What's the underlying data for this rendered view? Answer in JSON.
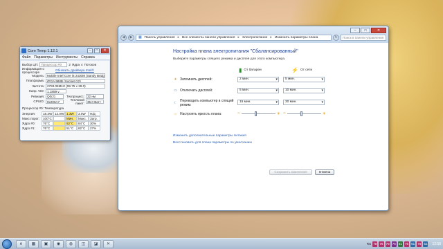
{
  "coretemp": {
    "title": "Core Temp 1.12.1",
    "menu": [
      "Файл",
      "Параметры",
      "Инструменты",
      "Справка"
    ],
    "cpu_select_label": "Выбор ЦП:",
    "cpu_select_value": "Процессор #0",
    "cores_value": "2",
    "cores_label": "Ядра",
    "threads_value": "4",
    "threads_label": "Потоков",
    "info_label": "Информация о процессоре",
    "info_link": "Обновить драйвера Intel®",
    "rows": [
      {
        "label": "Модель:",
        "value": "Mobile Intel Core i5 2430M (Sandy Bridge)"
      },
      {
        "label": "Платформа:",
        "value": "rPGA 988B (Socket G2)"
      },
      {
        "label": "Частота:",
        "value": "2793.08MHz (99.75 x 28.0)"
      },
      {
        "label": "Напр. VID:",
        "value": "1.1859 v"
      }
    ],
    "revision_label": "Ревизия:",
    "revision_value": "Q0/J1",
    "lithography_label": "Техпроцесс:",
    "lithography_value": "32 нм",
    "cpuid_label": "CPUID:",
    "cpuid_value": "0x206A7",
    "tdp_label": "Тепловой пакет:",
    "tdp_value": "35.0 Ватт",
    "proc_temp_label": "Процессор #0: Температура",
    "grid": {
      "rows": [
        {
          "label": "Энергия:",
          "cells": [
            "18.3W",
            "12.0W",
            "1.3W",
            "3.0W",
            "Н/Д"
          ]
        },
        {
          "label": "Макс.порог:",
          "cells": [
            "100°C",
            "",
            "Мин.",
            "Макс.",
            "Загр."
          ]
        },
        {
          "label": "Ядро #0:",
          "cells": [
            "76°C",
            "",
            "52°C",
            "84°C",
            "30%"
          ]
        },
        {
          "label": "Ядро #1:",
          "cells": [
            "76°C",
            "",
            "51°C",
            "82°C",
            "27%"
          ]
        }
      ]
    }
  },
  "control_panel": {
    "breadcrumb": [
      "Панель управления",
      "Все элементы панели управления",
      "Электропитание",
      "Изменить параметры плана"
    ],
    "search_placeholder": "Поиск в панели управления",
    "heading": "Настройка плана электропитания \"Сбалансированный\"",
    "description": "Выберите параметры спящего режима и дисплея для этого компьютера.",
    "col_battery": "От батареи",
    "col_ac": "От сети",
    "settings": [
      {
        "label": "Затемнить дисплей:",
        "battery": "2 мин.",
        "ac": "5 мин."
      },
      {
        "label": "Отключать дисплей:",
        "battery": "5 мин.",
        "ac": "10 мин."
      },
      {
        "label": "Переводить компьютер в спящий режим:",
        "battery": "15 мин.",
        "ac": "30 мин."
      }
    ],
    "brightness_label": "Настроить яркость плана:",
    "brightness_battery": 0.4,
    "brightness_ac": 0.4,
    "link_advanced": "Изменить дополнительные параметры питания",
    "link_restore": "Восстановить для плана параметры по умолчанию",
    "save_button": "Сохранить изменения",
    "cancel_button": "Отмена"
  },
  "taskbar": {
    "apps": [
      "e",
      "▦",
      "▣",
      "◉",
      "◍",
      "◫",
      "◪",
      "✕"
    ],
    "tray_items": [
      {
        "text": "78",
        "color": "#b0306a"
      },
      {
        "text": "76",
        "color": "#b0306a"
      },
      {
        "text": "79",
        "color": "#b0306a"
      },
      {
        "text": "76",
        "color": "#7a2f8a"
      },
      {
        "text": "51",
        "color": "#2f7a3a"
      },
      {
        "text": "76",
        "color": "#b0306a"
      },
      {
        "text": "51",
        "color": "#2f6aa8"
      },
      {
        "text": "76",
        "color": "#b0306a"
      },
      {
        "text": "51",
        "color": "#2f6aa8"
      }
    ],
    "lang": "RU",
    "clock": "12:58"
  }
}
